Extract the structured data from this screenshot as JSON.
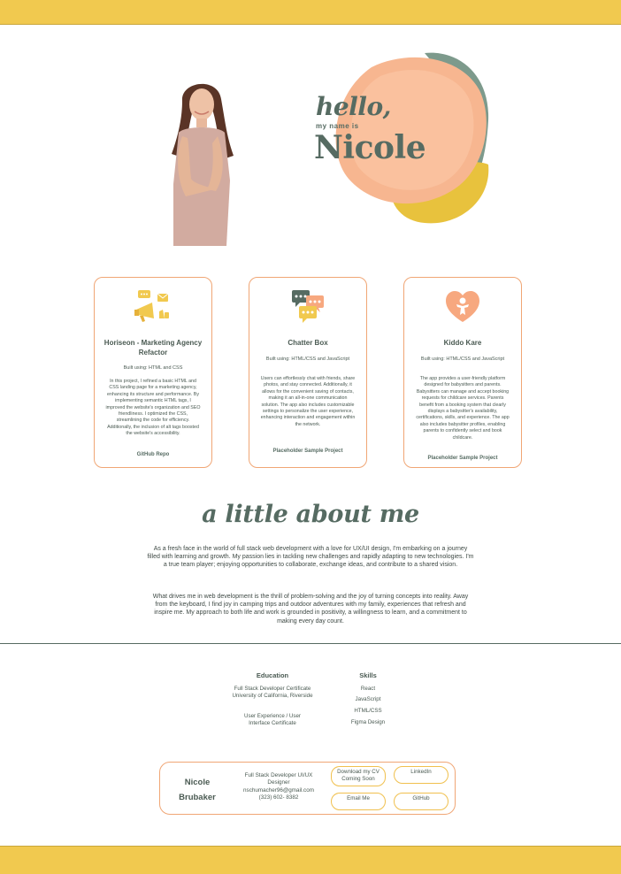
{
  "colors": {
    "accent_yellow": "#f1c94f",
    "peach": "#f0a675",
    "sage": "#566b62",
    "text": "#4a5a52"
  },
  "hero": {
    "hello": "hello,",
    "my_name_is": "my name is",
    "name": "Nicole",
    "photo_icon": "portrait-photo"
  },
  "projects": [
    {
      "icon": "megaphone-icon",
      "title": "Horiseon - Marketing Agency Refactor",
      "built": "Built using: HTML and CSS",
      "description": "In this project, I refined a basic HTML and CSS landing page for a marketing agency, enhancing its structure and performance. By implementing semantic HTML tags, I improved the website's organization and SEO friendliness. I optimized the CSS, streamlining the code for efficiency. Additionally, the inclusion of alt tags boosted the website's accessibility.",
      "link": "GitHub Repo"
    },
    {
      "icon": "chat-bubbles-icon",
      "title": "Chatter Box",
      "built": "Built using: HTML/CSS and JavaScript",
      "description": "Users can effortlessly chat with friends, share photos, and stay connected. Additionally, it allows for the convenient saving of contacts, making it an all-in-one communication solution. The app also includes customizable settings to personalize the user experience, enhancing interaction and engagement within the network.",
      "link": "Placeholder Sample Project"
    },
    {
      "icon": "heart-child-icon",
      "title": "Kiddo Kare",
      "built": "Built using: HTML/CSS and JavaScript",
      "description": "The app provides a user-friendly platform designed for babysitters and parents. Babysitters can manage and accept booking requests for childcare services. Parents benefit from a booking system that clearly displays a babysitter's availability, certifications, skills, and experience. The app also includes babysitter profiles, enabling parents to confidently select and book childcare.",
      "link": "Placeholder Sample Project"
    }
  ],
  "about": {
    "title": "a little about me",
    "p1": "As a fresh face in the world of full stack web development with a love for UX/UI design, I'm embarking on a journey filled with learning and growth. My passion lies in tackling new challenges and rapidly adapting to new technologies. I'm a true team player; enjoying opportunities to collaborate, exchange ideas, and contribute to a shared vision.",
    "p2": "What drives me in web development is the thrill of problem-solving and the joy of turning concepts into reality. Away from the keyboard, I find joy in camping trips and outdoor adventures with my family, experiences that refresh and inspire me. My approach to both life and work is grounded in positivity, a willingness to learn, and a commitment to making every day count."
  },
  "education": {
    "heading": "Education",
    "items": [
      "Full Stack Developer Certificate University of California, Riverside",
      "User Experience / User Interface Certificate"
    ]
  },
  "skills": {
    "heading": "Skills",
    "items": [
      "React",
      "JavaScript",
      "HTML/CSS",
      "Figma Design"
    ]
  },
  "contact": {
    "name": "Nicole Brubaker",
    "role": "Full Stack Developer UI/UX Designer",
    "email": "nschumacher96@gmail.com",
    "phone": "(323) 602- 8382",
    "buttons": {
      "cv": "Download my CV Coming Soon",
      "linkedin": "LinkedIn",
      "email": "Email Me",
      "github": "GitHub"
    }
  }
}
